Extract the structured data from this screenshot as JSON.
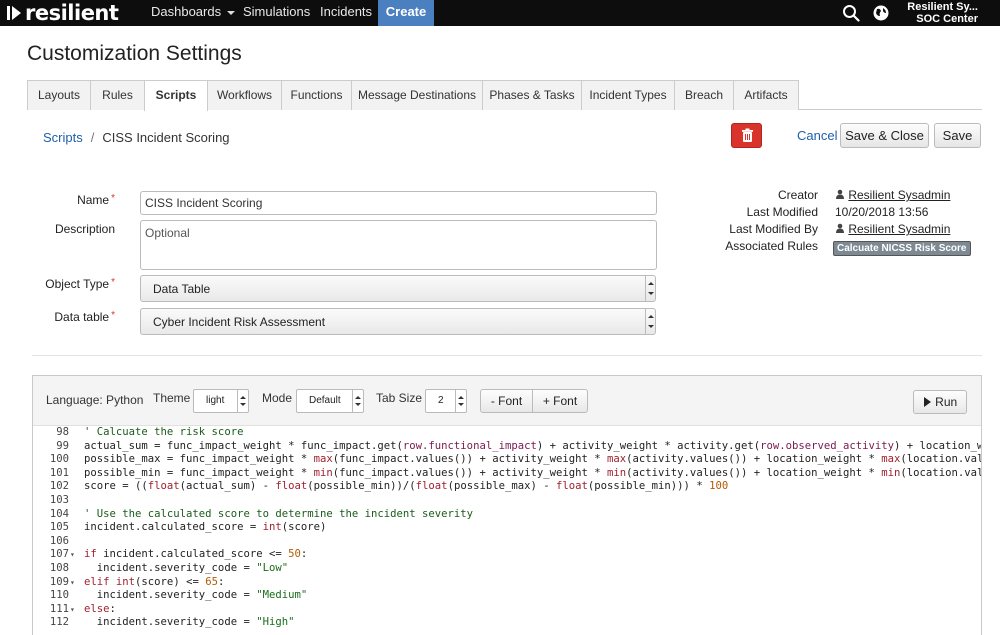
{
  "app": {
    "logo_text": "resilient"
  },
  "nav": {
    "items": [
      {
        "label": "Dashboards"
      },
      {
        "label": "Simulations"
      },
      {
        "label": "Incidents"
      },
      {
        "label": "Create"
      }
    ],
    "user_name": "Resilient Sy...",
    "user_org": "SOC Center"
  },
  "page": {
    "title": "Customization Settings"
  },
  "tabs": [
    "Layouts",
    "Rules",
    "Scripts",
    "Workflows",
    "Functions",
    "Message Destinations",
    "Phases & Tasks",
    "Incident Types",
    "Breach",
    "Artifacts"
  ],
  "active_tab": "Scripts",
  "breadcrumb": {
    "parent": "Scripts",
    "sep": "/",
    "current": "CISS Incident Scoring"
  },
  "actions": {
    "cancel": "Cancel",
    "save_close": "Save & Close",
    "save": "Save"
  },
  "form": {
    "name_label": "Name",
    "name_value": "CISS Incident Scoring",
    "description_label": "Description",
    "description_placeholder": "Optional",
    "object_type_label": "Object Type",
    "object_type_value": "Data Table",
    "data_table_label": "Data table",
    "data_table_value": "Cyber Incident Risk Assessment",
    "required_marker": "*"
  },
  "meta": {
    "creator_label": "Creator",
    "creator_value": "Resilient Sysadmin",
    "last_modified_label": "Last Modified",
    "last_modified_value": "10/20/2018 13:56",
    "last_modified_by_label": "Last Modified By",
    "last_modified_by_value": "Resilient Sysadmin",
    "associated_rules_label": "Associated Rules",
    "associated_rule": "Calcuate NICSS Risk Score"
  },
  "editor": {
    "language_label": "Language: Python",
    "theme_label": "Theme",
    "theme_value": "light",
    "mode_label": "Mode",
    "mode_value": "Default",
    "tab_size_label": "Tab Size",
    "tab_size_value": "2",
    "font_minus": "- Font",
    "font_plus": "+ Font",
    "run_label": "Run",
    "lines": [
      {
        "n": "98",
        "fold": "",
        "text": "' Calcuate the risk score"
      },
      {
        "n": "99",
        "fold": "",
        "text": "actual_sum = func_impact_weight * func_impact.get(row.functional_impact) + activity_weight * activity.get(row.observed_activity) + location_weight *"
      },
      {
        "n": "100",
        "fold": "",
        "text": "possible_max = func_impact_weight * max(func_impact.values()) + activity_weight * max(activity.values()) + location_weight * max(location.values()) +"
      },
      {
        "n": "101",
        "fold": "",
        "text": "possible_min = func_impact_weight * min(func_impact.values()) + activity_weight * min(activity.values()) + location_weight * min(location.values()) +"
      },
      {
        "n": "102",
        "fold": "",
        "text": "score = ((float(actual_sum) - float(possible_min))/(float(possible_max) - float(possible_min))) * 100"
      },
      {
        "n": "103",
        "fold": "",
        "text": ""
      },
      {
        "n": "104",
        "fold": "",
        "text": "' Use the calculated score to determine the incident severity"
      },
      {
        "n": "105",
        "fold": "",
        "text": "incident.calculated_score = int(score)"
      },
      {
        "n": "106",
        "fold": "",
        "text": ""
      },
      {
        "n": "107",
        "fold": "▾",
        "text": "if incident.calculated_score <= 50:"
      },
      {
        "n": "108",
        "fold": "",
        "text": "  incident.severity_code = \"Low\""
      },
      {
        "n": "109",
        "fold": "▾",
        "text": "elif int(score) <= 65:"
      },
      {
        "n": "110",
        "fold": "",
        "text": "  incident.severity_code = \"Medium\""
      },
      {
        "n": "111",
        "fold": "▾",
        "text": "else:"
      },
      {
        "n": "112",
        "fold": "",
        "text": "  incident.severity_code = \"High\""
      }
    ]
  },
  "colors": {
    "nav_bg": "#0d0d0d",
    "create_bg": "#4a7fc0",
    "link": "#1f5fa8",
    "delete": "#d9342b",
    "badge_bg": "#7d8a93"
  }
}
